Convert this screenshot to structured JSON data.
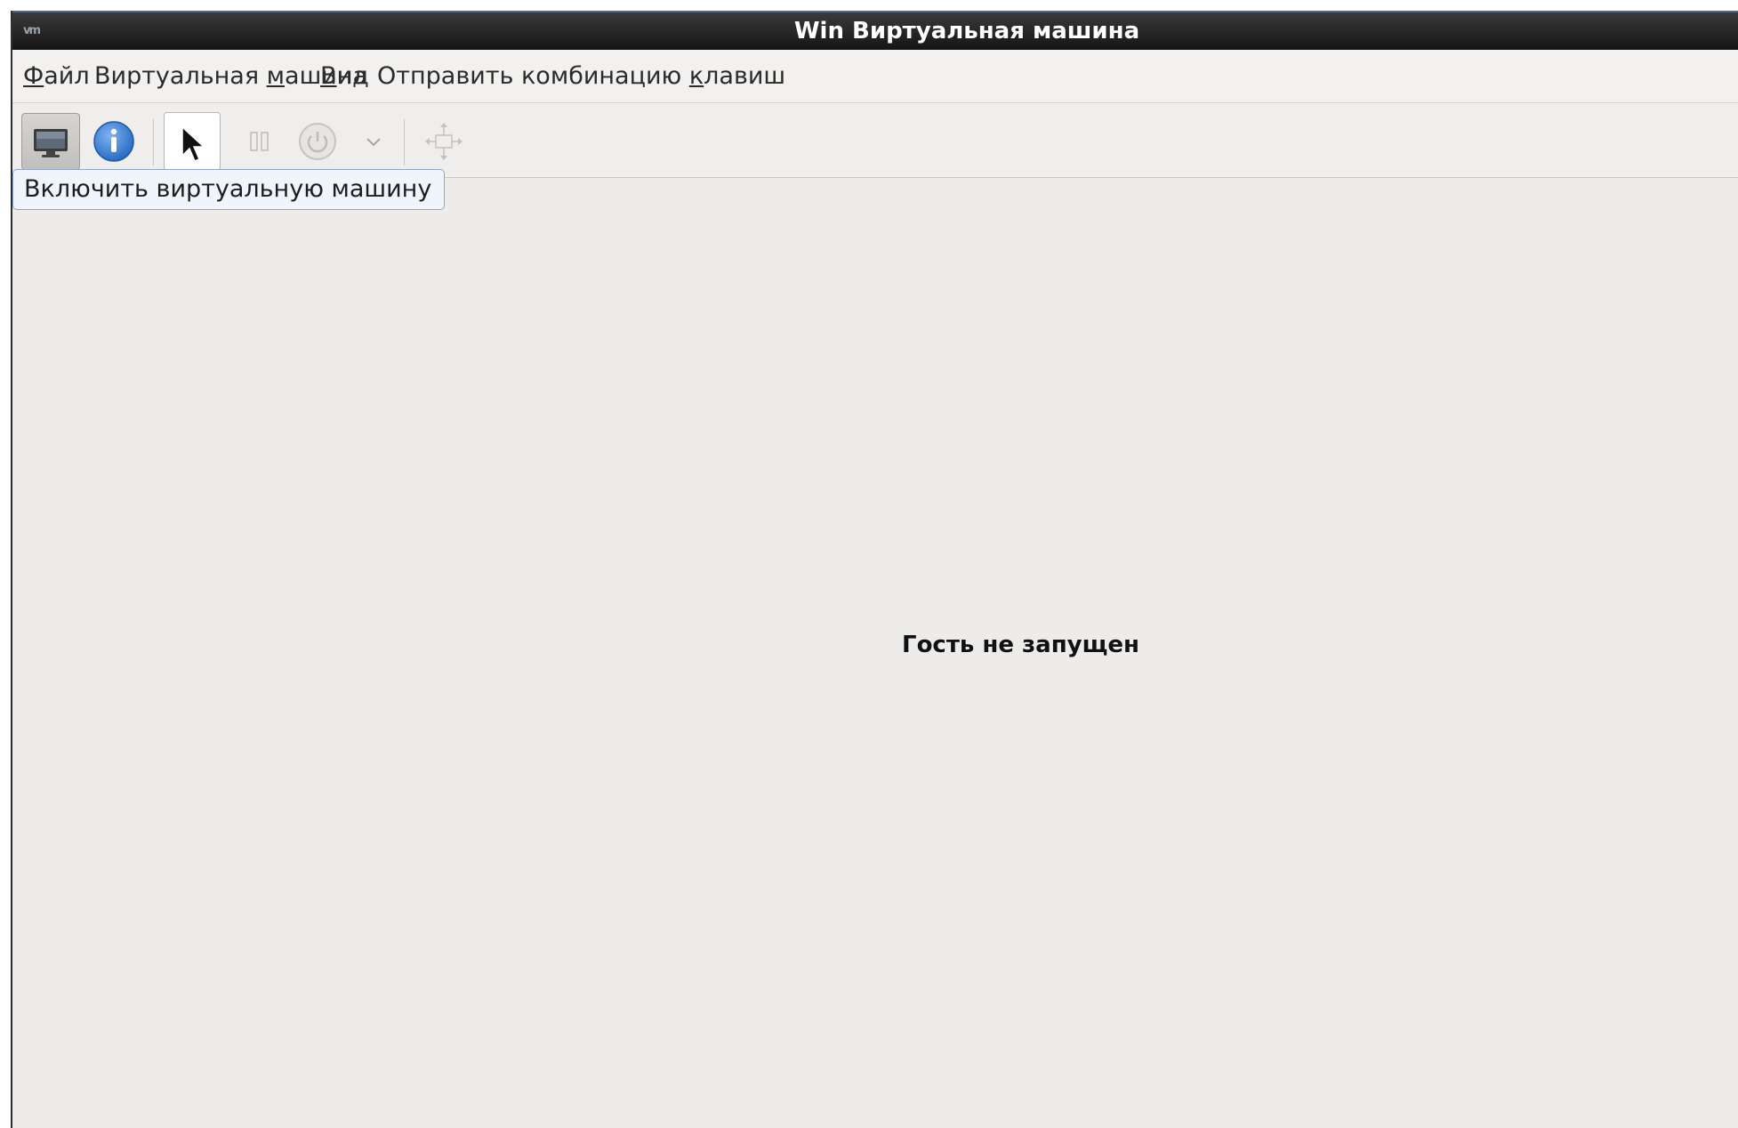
{
  "window": {
    "title": "Win Виртуальная машина",
    "app_icon_text": "vm"
  },
  "menubar": {
    "file": {
      "mnemonic": "Ф",
      "rest": "айл"
    },
    "vm": {
      "before": "Виртуальная ",
      "mnemonic": "м",
      "rest": "ашина"
    },
    "view": {
      "mnemonic": "В",
      "rest": "ид"
    },
    "send_key": {
      "before": "Отправить комбинацию ",
      "mnemonic": "к",
      "rest": "лавиш"
    }
  },
  "toolbar": {
    "buttons": [
      {
        "icon": "monitor-icon",
        "state": "pressed"
      },
      {
        "icon": "info-icon"
      },
      {
        "icon": "pointer-icon",
        "state": "hovered"
      },
      {
        "icon": "pause-icon",
        "state": "disabled"
      },
      {
        "icon": "power-icon",
        "state": "disabled"
      },
      {
        "icon": "chevron-down-icon",
        "state": "disabled"
      },
      {
        "icon": "fullscreen-move-icon",
        "state": "disabled"
      }
    ]
  },
  "tooltip": {
    "text": "Включить виртуальную машину"
  },
  "console": {
    "status_message": "Гость не запущен"
  },
  "colors": {
    "titlebar_bg": "#1f1f1f",
    "window_bg": "#edecea",
    "info_blue": "#3b82d8",
    "tooltip_bg": "#f0f4fb"
  }
}
